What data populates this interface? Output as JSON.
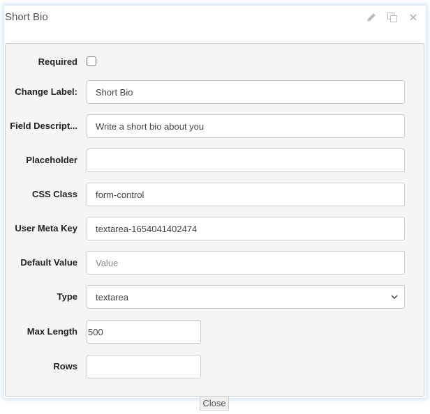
{
  "dialog": {
    "title": "Short Bio",
    "actions": [
      {
        "name": "edit",
        "icon": "pencil-icon"
      },
      {
        "name": "duplicate",
        "icon": "copy-icon"
      },
      {
        "name": "close",
        "icon": "close-icon"
      }
    ]
  },
  "fields": {
    "required": {
      "label": "Required",
      "checked": false
    },
    "change_label": {
      "label": "Change Label:",
      "value": "Short Bio"
    },
    "field_description": {
      "label": "Field Descript...",
      "value": "Write a short bio about you"
    },
    "placeholder": {
      "label": "Placeholder",
      "value": ""
    },
    "css_class": {
      "label": "CSS Class",
      "value": "form-control"
    },
    "user_meta_key": {
      "label": "User Meta Key",
      "value": "textarea-1654041402474"
    },
    "default_value": {
      "label": "Default Value",
      "value": "",
      "placeholder": "Value"
    },
    "type": {
      "label": "Type",
      "selected": "textarea"
    },
    "max_length": {
      "label": "Max Length",
      "value": "500"
    },
    "rows": {
      "label": "Rows",
      "value": ""
    }
  },
  "footer": {
    "close_label": "Close"
  }
}
